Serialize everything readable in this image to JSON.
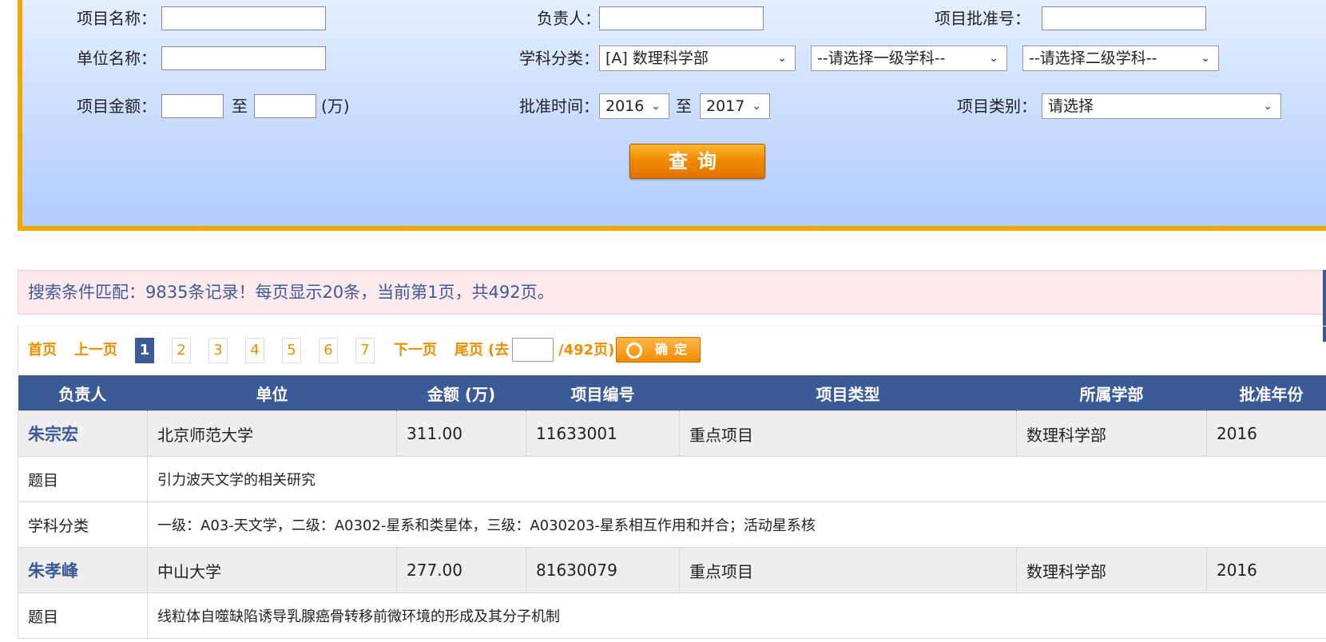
{
  "search": {
    "project_name_label": "项目名称：",
    "pi_label": "负责人：",
    "approval_no_label": "项目批准号：",
    "unit_name_label": "单位名称：",
    "discipline_label": "学科分类：",
    "discipline_value": "[A] 数理科学部",
    "level1_value": "--请选择一级学科--",
    "level2_value": "--请选择二级学科--",
    "amount_label": "项目金额：",
    "amount_to": "至",
    "amount_unit": "(万)",
    "approval_time_label": "批准时间：",
    "year_from": "2016",
    "year_to_label": "至",
    "year_to": "2017",
    "category_label": "项目类别：",
    "category_value": "请选择",
    "query_button": "查询"
  },
  "result_summary": "搜索条件匹配：9835条记录！每页显示20条，当前第1页，共492页。",
  "pager": {
    "first": "首页",
    "prev": "上一页",
    "pages": [
      "1",
      "2",
      "3",
      "4",
      "5",
      "6",
      "7"
    ],
    "current_page": "1",
    "next": "下一页",
    "last": "尾页",
    "goto_prefix": "(去",
    "goto_suffix": "/492页)",
    "ok_button": "确定"
  },
  "table": {
    "headers": {
      "pi": "负责人",
      "unit": "单位",
      "amount": "金额 (万)",
      "project_no": "项目编号",
      "type": "项目类型",
      "department": "所属学部",
      "year": "批准年份"
    },
    "title_label": "题目",
    "discipline_label": "学科分类",
    "rows": [
      {
        "pi": "朱宗宏",
        "unit": "北京师范大学",
        "amount": "311.00",
        "project_no": "11633001",
        "type": "重点项目",
        "department": "数理科学部",
        "year": "2016",
        "title": "引力波天文学的相关研究",
        "discipline": "一级：A03-天文学，二级：A0302-星系和类星体，三级：A030203-星系相互作用和并合；活动星系核"
      },
      {
        "pi": "朱孝峰",
        "unit": "中山大学",
        "amount": "277.00",
        "project_no": "81630079",
        "type": "重点项目",
        "department": "数理科学部",
        "year": "2016",
        "title": "线粒体自噬缺陷诱导乳腺癌骨转移前微环境的形成及其分子机制"
      }
    ]
  },
  "colors": {
    "accent_orange": "#f08c00",
    "header_blue": "#3b5a98",
    "panel_border": "#f0a800",
    "result_bg": "#fdeaec"
  }
}
